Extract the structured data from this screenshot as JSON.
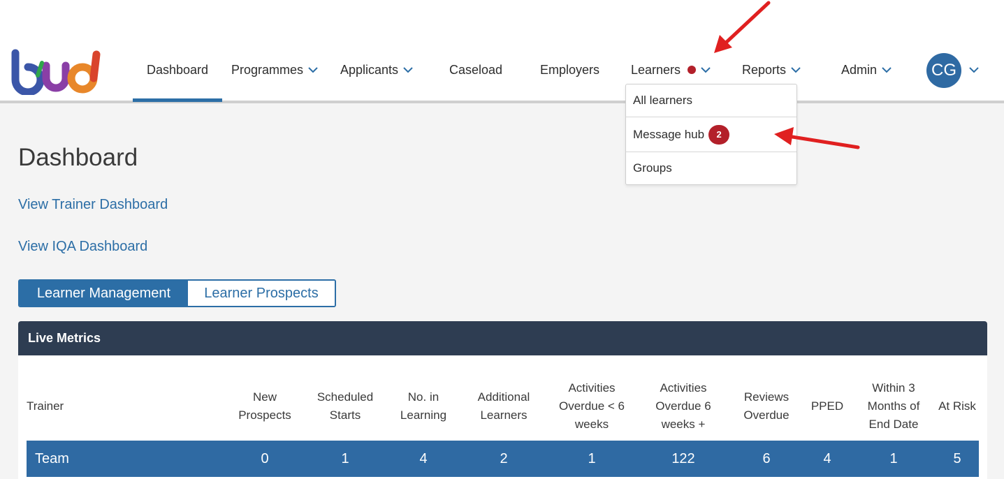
{
  "nav": {
    "items": [
      {
        "label": "Dashboard"
      },
      {
        "label": "Programmes"
      },
      {
        "label": "Applicants"
      },
      {
        "label": "Caseload"
      },
      {
        "label": "Employers"
      },
      {
        "label": "Learners"
      },
      {
        "label": "Reports"
      },
      {
        "label": "Admin"
      }
    ],
    "active": "Dashboard",
    "user_initials": "CG"
  },
  "learners_menu": {
    "items": [
      {
        "label": "All learners"
      },
      {
        "label": "Message hub",
        "badge": "2"
      },
      {
        "label": "Groups"
      }
    ]
  },
  "page": {
    "title": "Dashboard",
    "links": [
      "View Trainer Dashboard",
      "View IQA Dashboard"
    ],
    "tabs": [
      {
        "label": "Learner Management",
        "active": true
      },
      {
        "label": "Learner Prospects",
        "active": false
      }
    ]
  },
  "metrics": {
    "title": "Live Metrics",
    "columns": [
      "Trainer",
      "New Prospects",
      "Scheduled Starts",
      "No. in Learning",
      "Additional Learners",
      "Activities Overdue < 6 weeks",
      "Activities Overdue 6 weeks +",
      "Reviews Overdue",
      "PPED",
      "Within 3 Months of End Date",
      "At Risk"
    ],
    "rows": [
      [
        "Team",
        "0",
        "1",
        "4",
        "2",
        "1",
        "122",
        "6",
        "4",
        "1",
        "5"
      ]
    ]
  },
  "colors": {
    "accent": "#2c6ea6",
    "header_dark": "#2e3d52",
    "notification": "#b3202a",
    "annotation_arrow": "#e02020"
  }
}
